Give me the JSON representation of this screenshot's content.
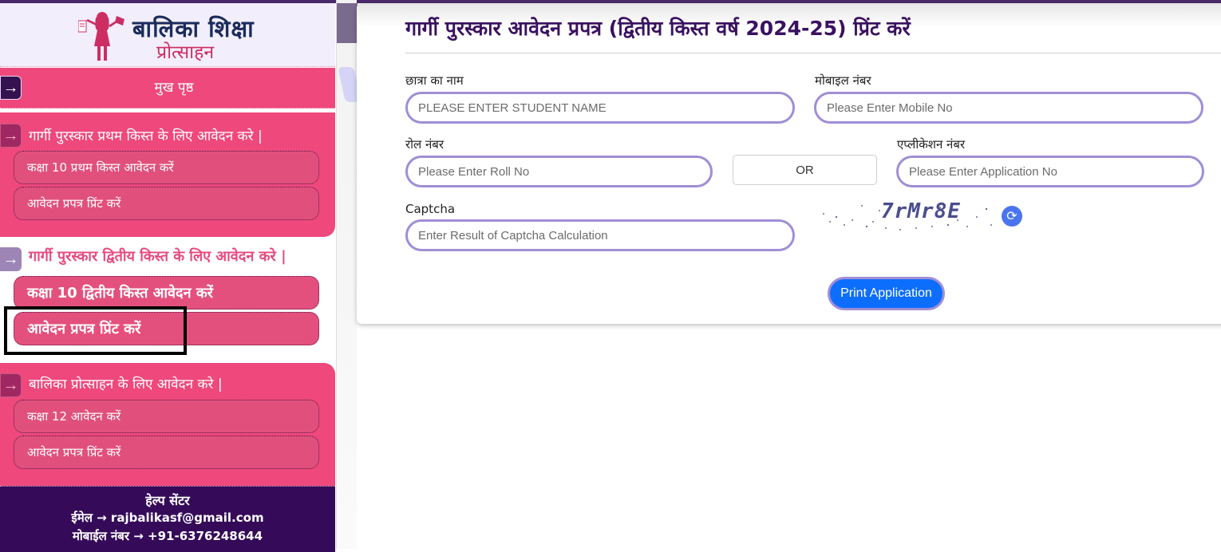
{
  "logo": {
    "title": "बालिका  शिक्षा",
    "subtitle": "प्रोत्साहन"
  },
  "sidebar": {
    "home_label": "मुख पृष्ठ",
    "section1": {
      "title": "गार्गी पुरस्कार प्रथम किस्त के लिए आवेदन करे |",
      "items": [
        "कक्षा 10 प्रथम किस्त आवेदन करें",
        "आवेदन प्रपत्र प्रिंट करें"
      ]
    },
    "section2": {
      "title": "गार्गी पुरस्कार द्वितीय किस्त के लिए आवेदन करे |",
      "items": [
        "कक्षा 10 द्वितीय किस्त आवेदन करें",
        "आवेदन प्रपत्र प्रिंट करें"
      ]
    },
    "section3": {
      "title": "बालिका प्रोत्साहन के लिए आवेदन करे |",
      "items": [
        "कक्षा 12 आवेदन करें",
        "आवेदन प्रपत्र प्रिंट करें"
      ]
    },
    "arrow_glyph": "→"
  },
  "help": {
    "title": "हेल्प सेंटर",
    "email_line": "ईमेल → rajbalikasf@gmail.com",
    "mobile_line": "मोबाईल नंबर → +91-6376248644"
  },
  "form": {
    "title": "गार्गी पुरस्कार आवेदन प्रपत्र (द्वितीय किस्त वर्ष 2024-25) प्रिंट करें",
    "student_name": {
      "label": "छात्रा का नाम",
      "placeholder": "PLEASE ENTER STUDENT NAME",
      "value": ""
    },
    "mobile": {
      "label": "मोबाइल नंबर",
      "placeholder": "Please Enter Mobile No",
      "value": ""
    },
    "roll_no": {
      "label": "रोल नंबर",
      "placeholder": "Please Enter Roll No",
      "value": ""
    },
    "or_label": "OR",
    "application_no": {
      "label": "एप्लीकेशन नंबर",
      "placeholder": "Please Enter Application No",
      "value": ""
    },
    "captcha": {
      "label": "Captcha",
      "placeholder": "Enter Result of Captcha Calculation",
      "value": "",
      "image_text": "7rMr8E",
      "refresh_glyph": "⟳"
    },
    "print_button": "Print Application"
  },
  "colors": {
    "sidebar_pink": "#ee487d",
    "sidebar_dark": "#350b59",
    "title_purple": "#3a1260",
    "input_border": "#a08ed6",
    "primary_blue": "#0d6efd"
  }
}
